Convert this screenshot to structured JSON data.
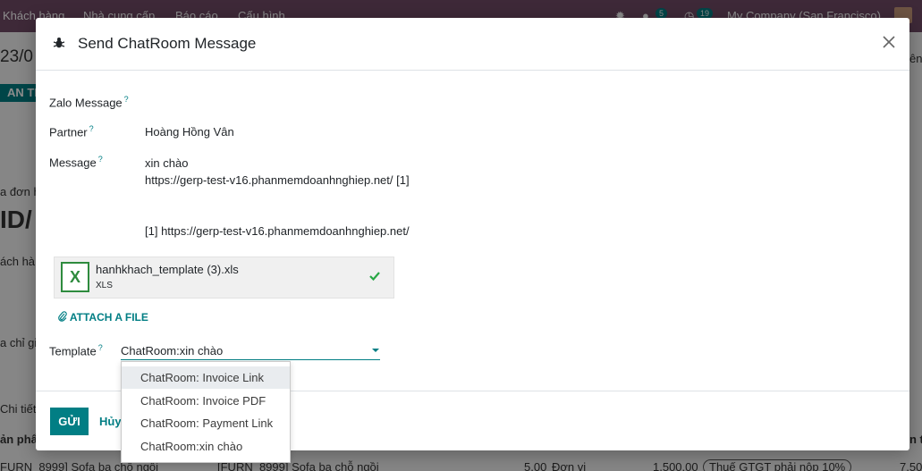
{
  "app": {
    "nav": [
      "Khách hàng",
      "Nhà cung cấp",
      "Báo cáo",
      "Cấu hình"
    ],
    "chat_count": "5",
    "activity_count": "19",
    "company": "My Company (San Francisco)"
  },
  "background": {
    "date_fragment": "23/0",
    "action_btn": "AN THA",
    "right_fragment": "ên",
    "order_fragment": "a đơn h",
    "id_fragment": "ID/",
    "customer_fragment": "ách hà",
    "address_fragment": "a chỉ gi",
    "detail_fragment": "Chi tiết",
    "product_fragment": "ản phẩ",
    "right_col_fragment": "n t",
    "row": {
      "product": "FURN_8999] Sofa ba chỗ ngồi",
      "description": "[FURN_8999] Sofa ba chỗ ngồi",
      "qty": "5,00",
      "uom": "Đơn vị",
      "price": "1.500,00",
      "tax": "Thuế GTGT phải nộp 10%",
      "total_fragment": "7.50"
    }
  },
  "modal": {
    "title": "Send ChatRoom Message",
    "section_label": "Zalo Message",
    "partner_label": "Partner",
    "partner_value": "Hoàng Hồng Vân",
    "message_label": "Message",
    "message_lines": [
      "xin chào",
      "https://gerp-test-v16.phanmemdoanhnghiep.net/ [1]",
      "",
      "",
      "[1] https://gerp-test-v16.phanmemdoanhnghiep.net/"
    ],
    "attachment": {
      "name": "hanhkhach_template (3).xls",
      "ext": "XLS",
      "icon_letter": "X"
    },
    "attach_label": "ATTACH A FILE",
    "template_label": "Template",
    "template_value": "ChatRoom:xin chào",
    "help_mark": "?",
    "send_label": "GỬI",
    "cancel_label": "Hủy"
  },
  "dropdown": {
    "options": [
      "ChatRoom: Invoice Link",
      "ChatRoom: Invoice PDF",
      "ChatRoom: Payment Link",
      "ChatRoom:xin chào"
    ],
    "highlighted_index": 0
  },
  "colors": {
    "brand": "#714b67",
    "accent": "#017e84",
    "excel_green": "#2e8b3e"
  }
}
